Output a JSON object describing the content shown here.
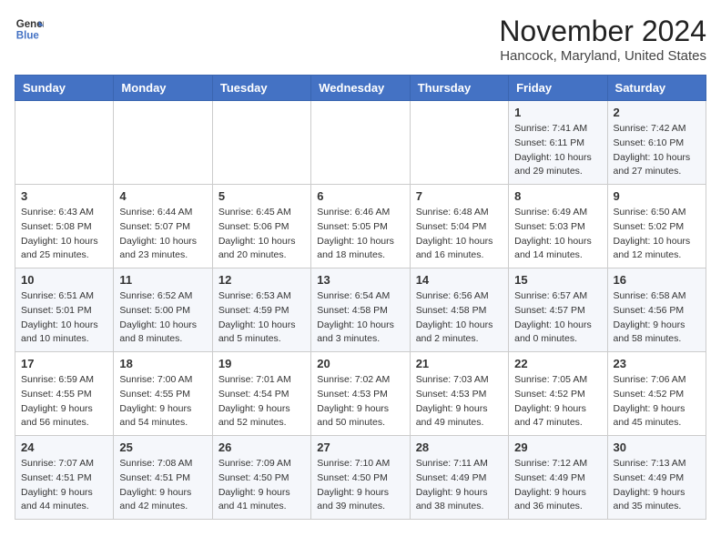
{
  "header": {
    "logo_line1": "General",
    "logo_line2": "Blue",
    "month": "November 2024",
    "location": "Hancock, Maryland, United States"
  },
  "weekdays": [
    "Sunday",
    "Monday",
    "Tuesday",
    "Wednesday",
    "Thursday",
    "Friday",
    "Saturday"
  ],
  "weeks": [
    [
      {
        "day": "",
        "info": ""
      },
      {
        "day": "",
        "info": ""
      },
      {
        "day": "",
        "info": ""
      },
      {
        "day": "",
        "info": ""
      },
      {
        "day": "",
        "info": ""
      },
      {
        "day": "1",
        "info": "Sunrise: 7:41 AM\nSunset: 6:11 PM\nDaylight: 10 hours and 29 minutes."
      },
      {
        "day": "2",
        "info": "Sunrise: 7:42 AM\nSunset: 6:10 PM\nDaylight: 10 hours and 27 minutes."
      }
    ],
    [
      {
        "day": "3",
        "info": "Sunrise: 6:43 AM\nSunset: 5:08 PM\nDaylight: 10 hours and 25 minutes."
      },
      {
        "day": "4",
        "info": "Sunrise: 6:44 AM\nSunset: 5:07 PM\nDaylight: 10 hours and 23 minutes."
      },
      {
        "day": "5",
        "info": "Sunrise: 6:45 AM\nSunset: 5:06 PM\nDaylight: 10 hours and 20 minutes."
      },
      {
        "day": "6",
        "info": "Sunrise: 6:46 AM\nSunset: 5:05 PM\nDaylight: 10 hours and 18 minutes."
      },
      {
        "day": "7",
        "info": "Sunrise: 6:48 AM\nSunset: 5:04 PM\nDaylight: 10 hours and 16 minutes."
      },
      {
        "day": "8",
        "info": "Sunrise: 6:49 AM\nSunset: 5:03 PM\nDaylight: 10 hours and 14 minutes."
      },
      {
        "day": "9",
        "info": "Sunrise: 6:50 AM\nSunset: 5:02 PM\nDaylight: 10 hours and 12 minutes."
      }
    ],
    [
      {
        "day": "10",
        "info": "Sunrise: 6:51 AM\nSunset: 5:01 PM\nDaylight: 10 hours and 10 minutes."
      },
      {
        "day": "11",
        "info": "Sunrise: 6:52 AM\nSunset: 5:00 PM\nDaylight: 10 hours and 8 minutes."
      },
      {
        "day": "12",
        "info": "Sunrise: 6:53 AM\nSunset: 4:59 PM\nDaylight: 10 hours and 5 minutes."
      },
      {
        "day": "13",
        "info": "Sunrise: 6:54 AM\nSunset: 4:58 PM\nDaylight: 10 hours and 3 minutes."
      },
      {
        "day": "14",
        "info": "Sunrise: 6:56 AM\nSunset: 4:58 PM\nDaylight: 10 hours and 2 minutes."
      },
      {
        "day": "15",
        "info": "Sunrise: 6:57 AM\nSunset: 4:57 PM\nDaylight: 10 hours and 0 minutes."
      },
      {
        "day": "16",
        "info": "Sunrise: 6:58 AM\nSunset: 4:56 PM\nDaylight: 9 hours and 58 minutes."
      }
    ],
    [
      {
        "day": "17",
        "info": "Sunrise: 6:59 AM\nSunset: 4:55 PM\nDaylight: 9 hours and 56 minutes."
      },
      {
        "day": "18",
        "info": "Sunrise: 7:00 AM\nSunset: 4:55 PM\nDaylight: 9 hours and 54 minutes."
      },
      {
        "day": "19",
        "info": "Sunrise: 7:01 AM\nSunset: 4:54 PM\nDaylight: 9 hours and 52 minutes."
      },
      {
        "day": "20",
        "info": "Sunrise: 7:02 AM\nSunset: 4:53 PM\nDaylight: 9 hours and 50 minutes."
      },
      {
        "day": "21",
        "info": "Sunrise: 7:03 AM\nSunset: 4:53 PM\nDaylight: 9 hours and 49 minutes."
      },
      {
        "day": "22",
        "info": "Sunrise: 7:05 AM\nSunset: 4:52 PM\nDaylight: 9 hours and 47 minutes."
      },
      {
        "day": "23",
        "info": "Sunrise: 7:06 AM\nSunset: 4:52 PM\nDaylight: 9 hours and 45 minutes."
      }
    ],
    [
      {
        "day": "24",
        "info": "Sunrise: 7:07 AM\nSunset: 4:51 PM\nDaylight: 9 hours and 44 minutes."
      },
      {
        "day": "25",
        "info": "Sunrise: 7:08 AM\nSunset: 4:51 PM\nDaylight: 9 hours and 42 minutes."
      },
      {
        "day": "26",
        "info": "Sunrise: 7:09 AM\nSunset: 4:50 PM\nDaylight: 9 hours and 41 minutes."
      },
      {
        "day": "27",
        "info": "Sunrise: 7:10 AM\nSunset: 4:50 PM\nDaylight: 9 hours and 39 minutes."
      },
      {
        "day": "28",
        "info": "Sunrise: 7:11 AM\nSunset: 4:49 PM\nDaylight: 9 hours and 38 minutes."
      },
      {
        "day": "29",
        "info": "Sunrise: 7:12 AM\nSunset: 4:49 PM\nDaylight: 9 hours and 36 minutes."
      },
      {
        "day": "30",
        "info": "Sunrise: 7:13 AM\nSunset: 4:49 PM\nDaylight: 9 hours and 35 minutes."
      }
    ]
  ]
}
